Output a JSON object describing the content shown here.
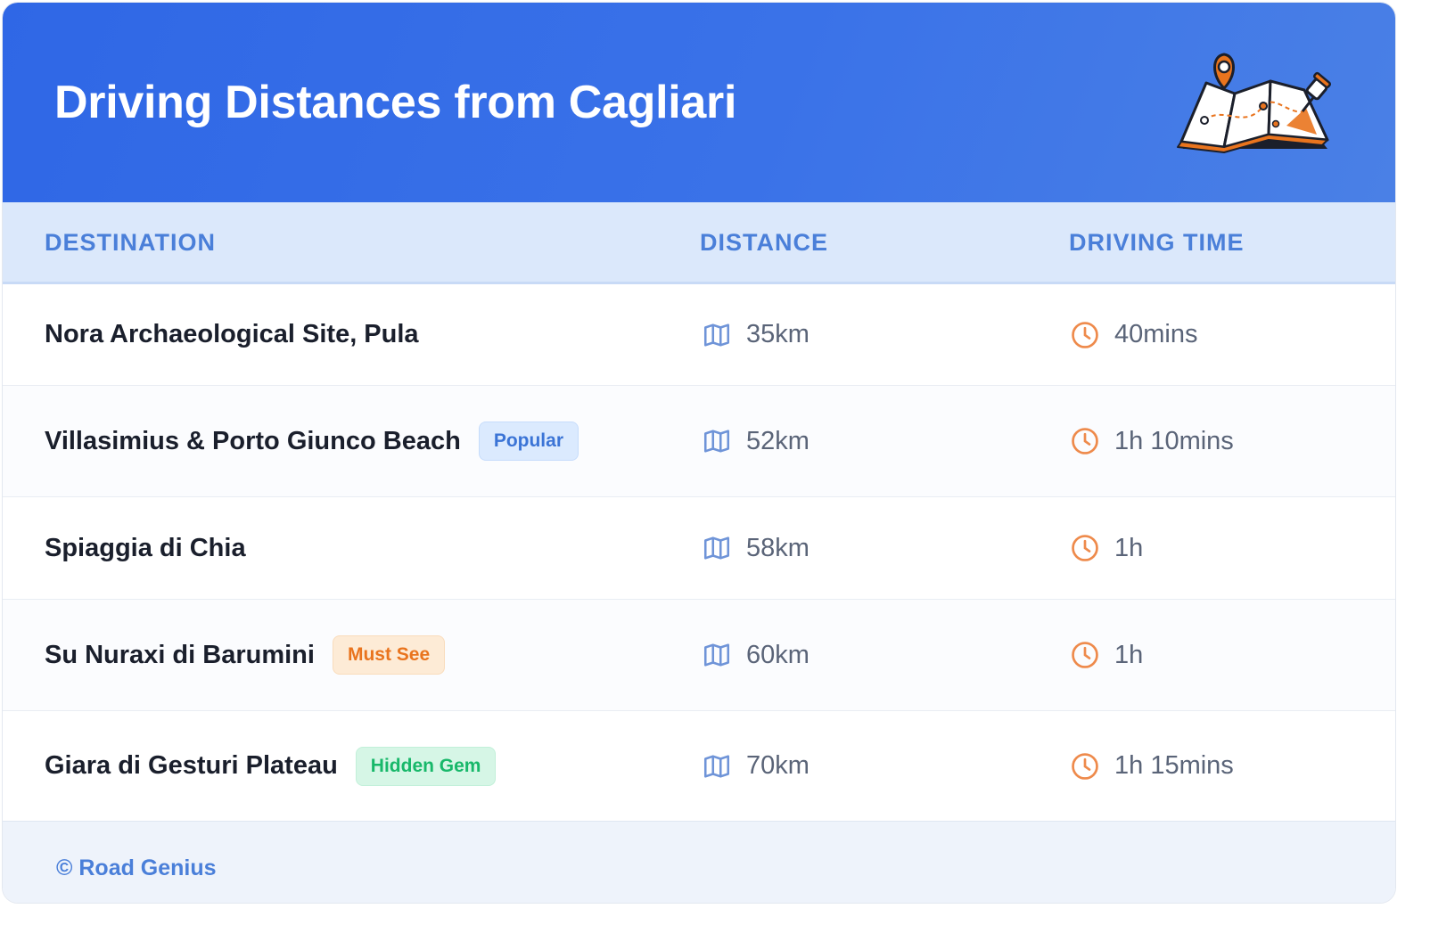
{
  "header": {
    "title": "Driving Distances from Cagliari",
    "illustration_icon": "folded-map-with-pins-icon"
  },
  "table": {
    "columns": [
      "DESTINATION",
      "DISTANCE",
      "DRIVING TIME"
    ],
    "rows": [
      {
        "destination": "Nora Archaeological Site, Pula",
        "badge": "",
        "distance": "35km",
        "time": "40mins"
      },
      {
        "destination": "Villasimius & Porto Giunco Beach",
        "badge": "Popular",
        "distance": "52km",
        "time": "1h 10mins"
      },
      {
        "destination": "Spiaggia di Chia",
        "badge": "",
        "distance": "58km",
        "time": "1h"
      },
      {
        "destination": "Su Nuraxi di Barumini",
        "badge": "Must See",
        "distance": "60km",
        "time": "1h"
      },
      {
        "destination": "Giara di Gesturi Plateau",
        "badge": "Hidden Gem",
        "distance": "70km",
        "time": "1h 15mins"
      }
    ],
    "distance_icon": "map-icon",
    "time_icon": "clock-icon"
  },
  "footer": {
    "text": "© Road Genius"
  },
  "colors": {
    "header_blue": "#2f67e6",
    "header_text_blue": "#4a7fd9",
    "clock_orange": "#ee8a4b",
    "map_icon_blue": "#6f94d8"
  }
}
